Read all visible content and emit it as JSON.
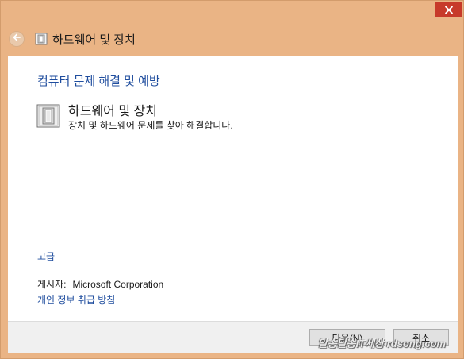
{
  "window": {
    "title": "하드웨어 및 장치",
    "close_icon": "close-icon",
    "back_icon": "back-arrow-icon",
    "title_icon": "device-icon"
  },
  "content": {
    "heading": "컴퓨터 문제 해결 및 예방",
    "item": {
      "title": "하드웨어 및 장치",
      "description": "장치 및 하드웨어 문제를 찾아 해결합니다.",
      "icon": "device-icon"
    },
    "advanced_link": "고급",
    "publisher_label": "게시자:",
    "publisher_value": "Microsoft Corporation",
    "privacy_link": "개인 정보 취급 방침"
  },
  "footer": {
    "next_label": "다음(N)",
    "cancel_label": "취소"
  },
  "watermark": "알송달송IT세상 rdsong.com",
  "colors": {
    "frame": "#eab485",
    "close": "#c73a2a",
    "link": "#1f4d9e",
    "footer": "#f0f0f0"
  }
}
